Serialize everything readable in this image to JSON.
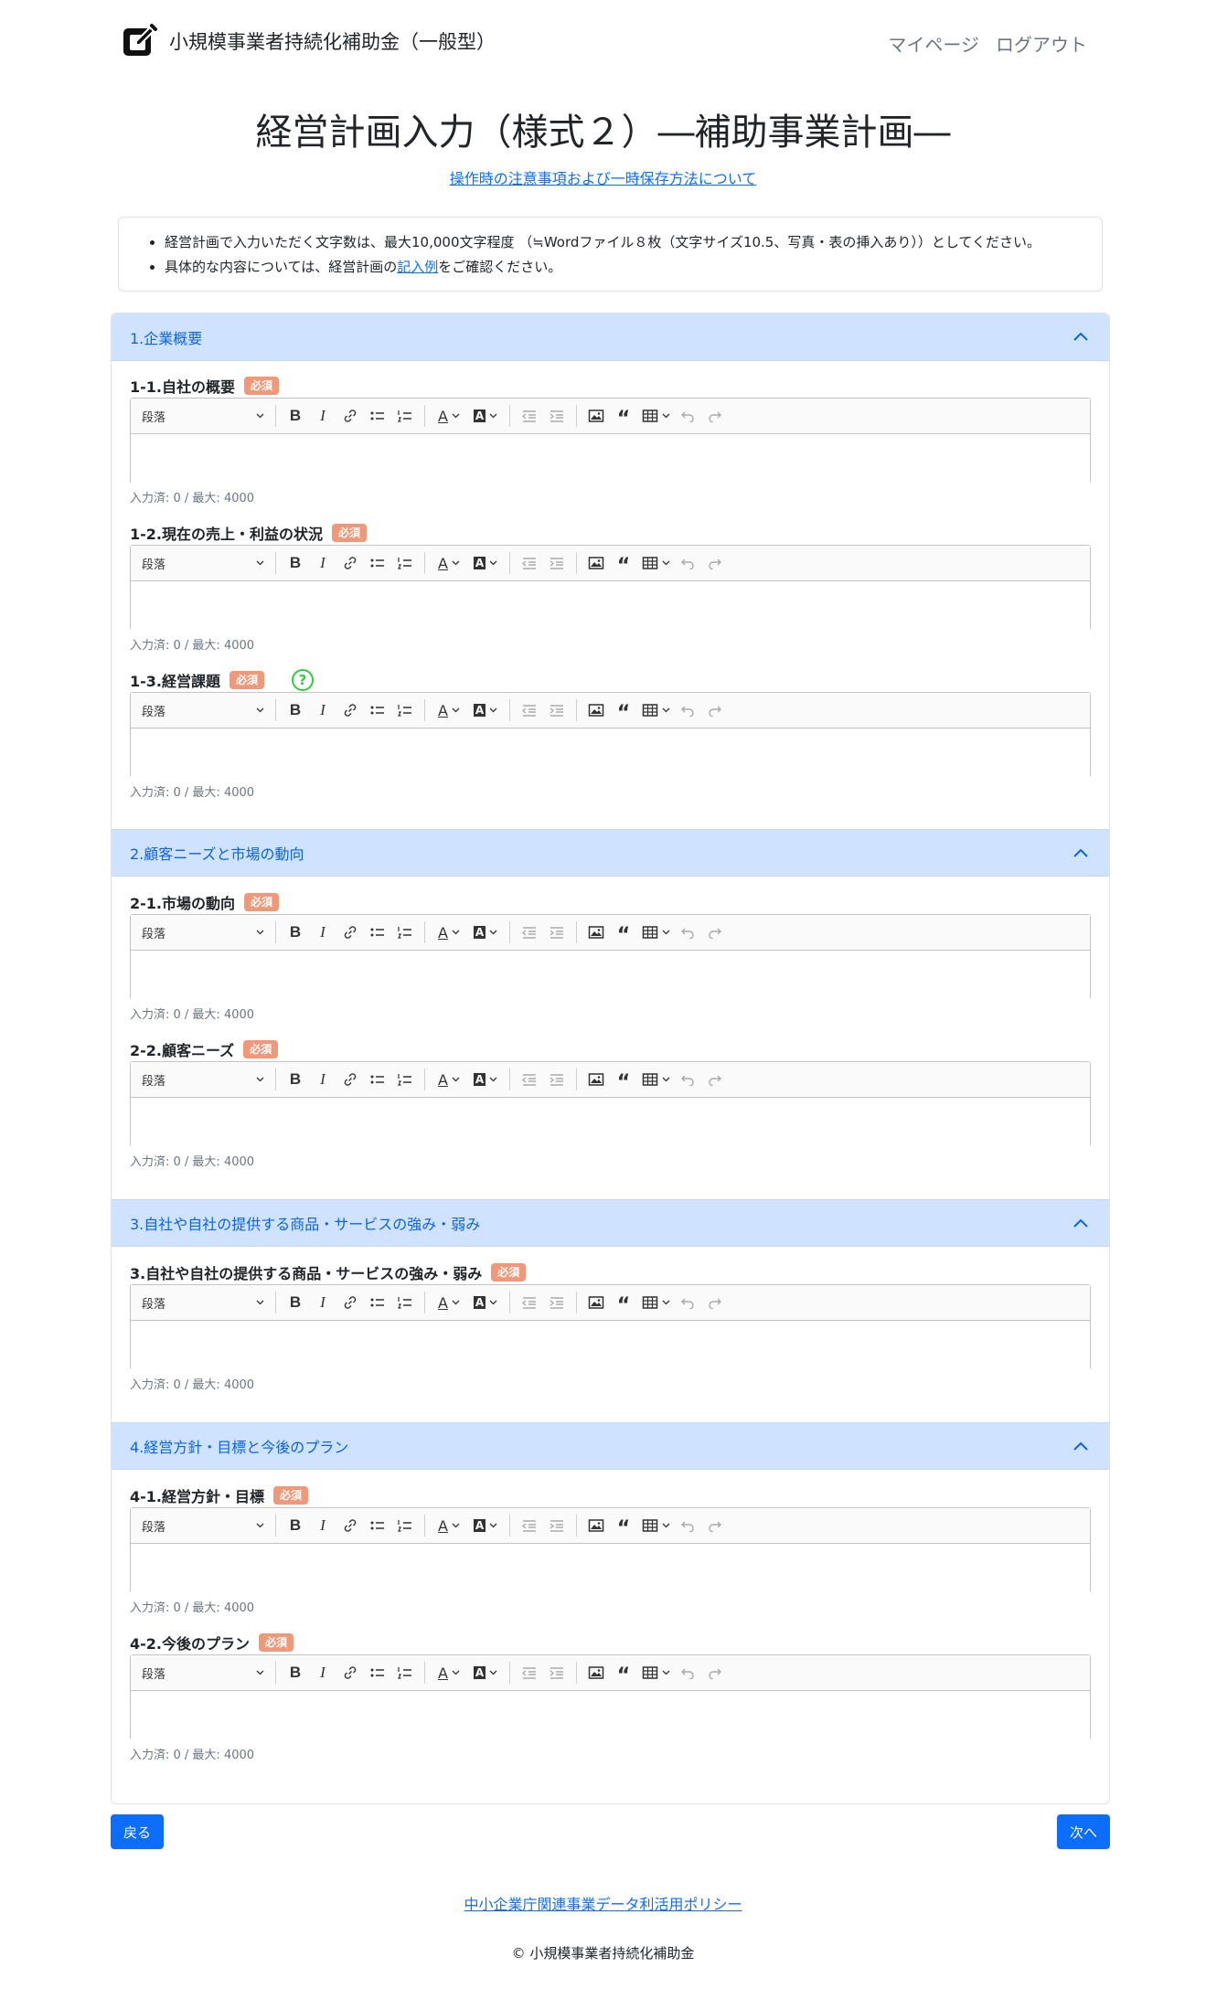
{
  "header": {
    "brand_title": "小規模事業者持続化補助金（一般型）",
    "nav": [
      "マイページ",
      "ログアウト"
    ]
  },
  "page": {
    "title": "経営計画入力（様式２）―補助事業計画―",
    "help_link": "操作時の注意事項および一時保存方法について"
  },
  "notice": {
    "line1": "経営計画で入力いただく文字数は、最大10,000文字程度 （≒Wordファイル８枚（文字サイズ10.5、写真・表の挿入あり））としてください。",
    "line2_prefix": "具体的な内容については、経営計画の",
    "line2_link": "記入例",
    "line2_suffix": "をご確認ください。"
  },
  "required_badge": "必須",
  "help_icon": "?",
  "editor": {
    "paragraph_label": "段落"
  },
  "sections": [
    {
      "title": "1.企業概要"
    },
    {
      "title": "2.顧客ニーズと市場の動向"
    },
    {
      "title": "3.自社や自社の提供する商品・サービスの強み・弱み"
    },
    {
      "title": "4.経営方針・目標と今後のプラン"
    }
  ],
  "fields": [
    {
      "label": "1-1.自社の概要",
      "counter": "入力済: 0 / 最大: 4000"
    },
    {
      "label": "1-2.現在の売上・利益の状況",
      "counter": "入力済: 0 / 最大: 4000"
    },
    {
      "label": "1-3.経営課題",
      "counter": "入力済: 0 / 最大: 4000"
    },
    {
      "label": "2-1.市場の動向",
      "counter": "入力済: 0 / 最大: 4000"
    },
    {
      "label": "2-2.顧客ニーズ",
      "counter": "入力済: 0 / 最大: 4000"
    },
    {
      "label": "3.自社や自社の提供する商品・サービスの強み・弱み",
      "counter": "入力済: 0 / 最大: 4000"
    },
    {
      "label": "4-1.経営方針・目標",
      "counter": "入力済: 0 / 最大: 4000"
    },
    {
      "label": "4-2.今後のプラン",
      "counter": "入力済: 0 / 最大: 4000"
    }
  ],
  "buttons": {
    "back": "戻る",
    "next": "次へ"
  },
  "footer": {
    "policy_link": "中小企業庁関連事業データ利活用ポリシー",
    "copyright": "© 小規模事業者持続化補助金"
  },
  "colors": {
    "accent": "#0d6efd",
    "accordion_bg": "#cfe2ff",
    "badge": "#f0987a",
    "help_icon": "#2ecc40"
  }
}
